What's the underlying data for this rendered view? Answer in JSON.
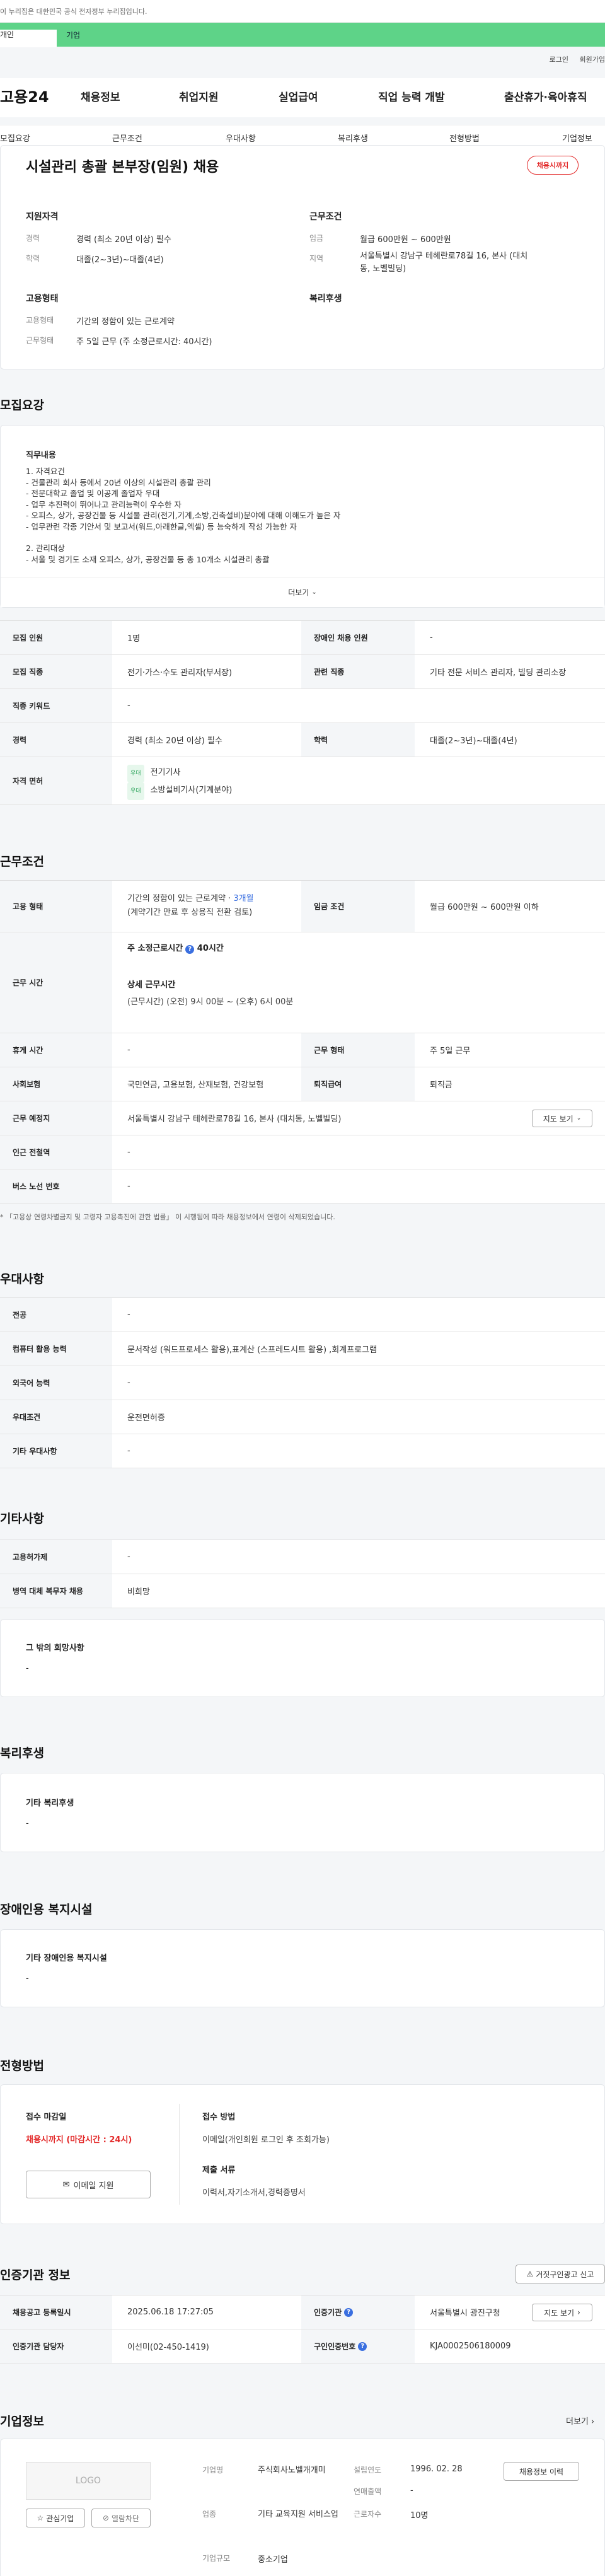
{
  "topbar": {
    "notice": "이 누리집은 대한민국 공식 전자정부 누리집입니다."
  },
  "greenbar": {
    "tab1": "개인",
    "tab2": "기업"
  },
  "util": {
    "login": "로그인",
    "join": "회원가입"
  },
  "gnb": {
    "logo": "고용24",
    "items": [
      "채용정보",
      "취업지원",
      "실업급여",
      "직업 능력 개발",
      "출산휴가·육아휴직"
    ]
  },
  "subnav": [
    "모집요강",
    "근무조건",
    "우대사항",
    "복리후생",
    "전형방법",
    "기업정보"
  ],
  "header": {
    "title": "시설관리 총괄 본부장(임원) 채용",
    "badge": "채용시까지",
    "qual_heading": "지원자격",
    "career_label": "경력",
    "career": "경력 (최소 20년 이상) 필수",
    "edu_label": "학력",
    "edu": "대졸(2~3년)~대졸(4년)",
    "cond_heading": "근무조건",
    "wage_label": "임금",
    "wage": "월급 600만원 ~ 600만원",
    "region_label": "지역",
    "region": "서울특별시 강남구 테헤란로78길 16, 본사 (대치동, 노벨빌딩)",
    "emp_heading": "고용형태",
    "emptype_label": "고용형태",
    "emptype": "기간의 정함이 있는 근로계약",
    "worktype_label": "근무형태",
    "worktype": "주 5일 근무 (주 소정근로시간: 40시간)",
    "welfare_heading": "복리후생"
  },
  "recruit": {
    "title": "모집요강",
    "duty_heading": "직무내용",
    "duty_lines": [
      "1. 자격요건",
      "- 건물관리 회사 등에서 20년 이상의 시설관리 총괄 관리",
      "- 전문대학교 졸업 및 이공계 졸업자 우대",
      "- 업무 추진력이 뛰어나고 관리능력이 우수한 자",
      "- 오피스, 상가, 공장건물 등 시설물 관리(전기,기계,소방,건축설비)분야에 대해 이해도가 높은 자",
      "- 업무관련 각종 기안서 및 보고서(워드,아래한글,엑셀) 등 능숙하게 작성 가능한 자",
      "",
      "2. 관리대상",
      "- 서울 및 경기도 소재 오피스, 상가, 공장건물 등 총 10개소 시설관리 총괄"
    ],
    "more": "더보기",
    "rows": [
      {
        "th": "모집 인원",
        "td": "1명",
        "th2": "장애인 채용 인원",
        "td2": "-"
      },
      {
        "th": "모집 직종",
        "td": "전기·가스·수도 관리자(부서장)",
        "th2": "관련 직종",
        "td2": "기타 전문 서비스 관리자, 빌딩 관리소장"
      },
      {
        "th": "직종 키워드",
        "td": "-"
      },
      {
        "th": "경력",
        "td": "경력 (최소 20년 이상) 필수",
        "th2": "학력",
        "td2": "대졸(2~3년)~대졸(4년)"
      }
    ],
    "license_th": "자격 면허",
    "license_tag": "우대",
    "licenses": [
      "전기기사",
      "소방설비기사(기계분야)"
    ]
  },
  "work": {
    "title": "근무조건",
    "emp_th": "고용 형태",
    "emp_td1": "기간의 정함이 있는 근로계약 · ",
    "emp_months": "3개월",
    "emp_td2": "(계약기간 만료 후 상용직 전환 검토)",
    "wage_th": "임금 조건",
    "wage_td": "월급 600만원 ~ 600만원 이하",
    "time_th": "근무 시간",
    "weekly": "주 소정근로시간",
    "weekly_val": "40시간",
    "detail_heading": "상세 근무시간",
    "detail": "(근무시간) (오전) 9시 00분 ~ (오후) 6시 00분",
    "rows": [
      {
        "th": "휴게 시간",
        "td": "-",
        "th2": "근무 형태",
        "td2": "주 5일 근무"
      },
      {
        "th": "사회보험",
        "td": "국민연금, 고용보험, 산재보험, 건강보험",
        "th2": "퇴직급여",
        "td2": "퇴직금"
      }
    ],
    "place_th": "근무 예정지",
    "place_td": "서울특별시 강남구 테헤란로78길 16, 본사 (대치동, 노벨빌딩)",
    "map_btn": "지도 보기",
    "station_th": "인근 전철역",
    "station_td": "-",
    "bus_th": "버스 노선 번호",
    "bus_td": "-",
    "note": "「고용상 연령차별금지 및 고령자 고용촉진에 관한 법률」 이 시행됨에 따라 채용정보에서 연령이 삭제되었습니다."
  },
  "pref": {
    "title": "우대사항",
    "rows": [
      {
        "th": "전공",
        "td": "-"
      },
      {
        "th": "컴퓨터 활용 능력",
        "td": "문서작성 (워드프로세스 활용),표계산 (스프레드시트 활용) ,회계프로그램"
      },
      {
        "th": "외국어 능력",
        "td": "-"
      },
      {
        "th": "우대조건",
        "td": "운전면허증"
      },
      {
        "th": "기타 우대사항",
        "td": "-"
      }
    ]
  },
  "etc": {
    "title": "기타사항",
    "rows": [
      {
        "th": "고용허가제",
        "td": "-"
      },
      {
        "th": "병역 대체 복무자 채용",
        "td": "비희망"
      }
    ],
    "box_heading": "그 밖의 희망사항",
    "box_val": "-"
  },
  "welfare": {
    "title": "복리후생",
    "heading": "기타 복리후생",
    "val": "-"
  },
  "disab": {
    "title": "장애인용 복지시설",
    "heading": "기타 장애인용 복지시설",
    "val": "-"
  },
  "process": {
    "title": "전형방법",
    "deadline_label": "접수 마감일",
    "deadline": "채용시까지 (마감시간 : 24시)",
    "email_btn": "이메일 지원",
    "method_label": "접수 방법",
    "method": "이메일(개인회원 로그인 후 조회가능)",
    "docs_label": "제출 서류",
    "docs": "이력서,자기소개서,경력증명서"
  },
  "auth": {
    "title": "인증기관 정보",
    "report_btn": "거짓구인광고 신고",
    "rows": [
      {
        "th": "채용공고 등록일시",
        "td": "2025.06.18 17:27:05",
        "th2": "인증기관",
        "td2": "서울특별시 광진구청",
        "btn": "지도 보기"
      },
      {
        "th": "인증기관 담당자",
        "td": "이선미(02-450-1419)",
        "th2": "구인인증번호",
        "td2": "KJA0002506180009"
      }
    ]
  },
  "company": {
    "title": "기업정보",
    "more": "더보기",
    "logo": "LOGO",
    "fav_btn": "관심기업",
    "block_btn": "열람차단",
    "name_label": "기업명",
    "name": "주식회사노벨개개미",
    "industry_label": "업종",
    "industry": "기타 교육지원 서비스업",
    "size_label": "기업규모",
    "size": "중소기업",
    "founded_label": "설립연도",
    "founded": "1996. 02. 28",
    "sales_label": "연매출액",
    "sales": "-",
    "staff_label": "근로자수",
    "staff": "10명",
    "jobs_btn": "채용정보 이력"
  }
}
